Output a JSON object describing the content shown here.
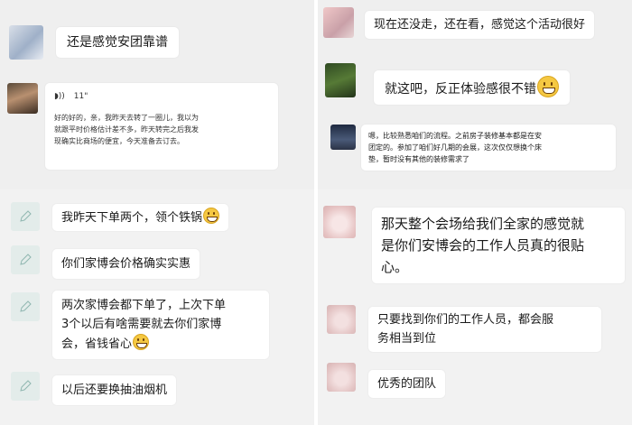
{
  "left_top": {
    "msg1": "还是感觉安团靠谱",
    "card": {
      "duration": "11\"",
      "lines": [
        "好的好的，亲，我昨天去转了一圈儿，我以为",
        "就跟平时价格估计差不多，昨天转完之后我发",
        "现确实比商场的便宜，今天准备去订去。"
      ]
    }
  },
  "left_bottom": {
    "msg1": "我昨天下单两个，领个铁锅",
    "msg2": "你们家博会价格确实实惠",
    "msg3_lines": [
      "两次家博会都下单了，上次下单",
      "3个以后有啥需要就去你们家博",
      "会，省钱省心"
    ],
    "msg4": "以后还要换抽油烟机"
  },
  "right_top": {
    "msg1": "现在还没走，还在看，感觉这个活动很好",
    "msg2": "就这吧，反正体验感很不错",
    "msg3_lines": [
      "嗯，比较熟悉咱们的流程。之前房子装修基本都是在安",
      "团定的。参加了咱们好几期的会展，这次仅仅想换个床",
      "垫，暂时没有其他的装修需求了"
    ]
  },
  "right_bottom": {
    "msg1_lines": [
      "那天整个会场给我们全家的感觉就",
      "是你们安博会的工作人员真的很贴",
      "心。"
    ],
    "msg2_lines": [
      "只要找到你们的工作人员，都会服",
      "务相当到位"
    ],
    "msg3": "优秀的团队"
  },
  "colors": {
    "panel_bg": "#efefef",
    "bubble_bg": "#ffffff",
    "text": "#1a1a1a",
    "emoji": "#f5c842"
  }
}
